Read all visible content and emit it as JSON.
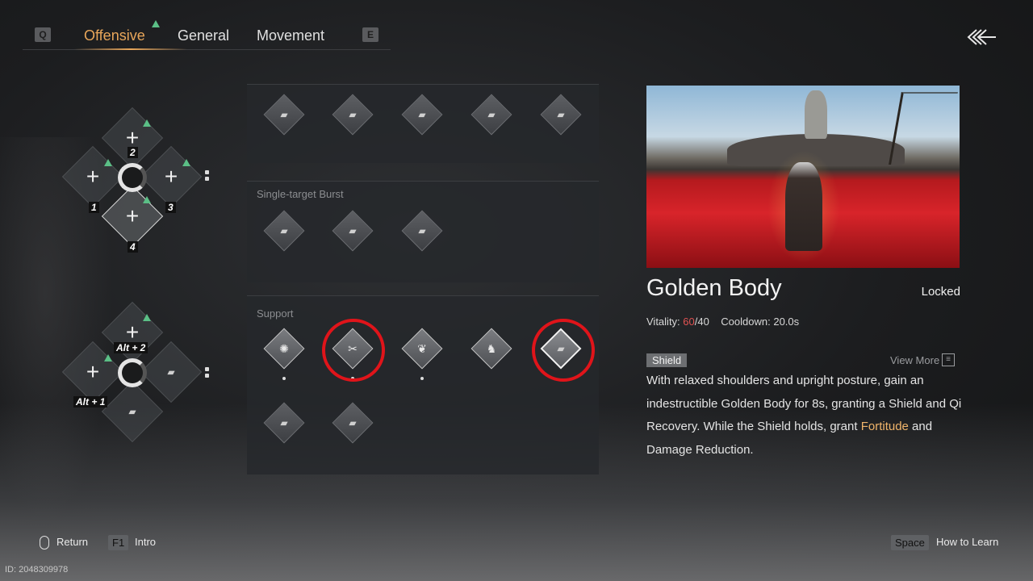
{
  "tabs": {
    "left_key": "Q",
    "right_key": "E",
    "items": [
      "Offensive",
      "General",
      "Movement"
    ],
    "active": "Offensive"
  },
  "wheel_upper": {
    "labels": [
      "2",
      "1",
      "3",
      "4"
    ]
  },
  "wheel_lower": {
    "labels": [
      "Alt + 2",
      "Alt + 1"
    ]
  },
  "skill_groups": [
    {
      "title": "",
      "count": 5
    },
    {
      "title": "Single-target Burst",
      "count": 3
    },
    {
      "title": "Support",
      "count": 7
    }
  ],
  "detail": {
    "name": "Golden Body",
    "status": "Locked",
    "vitality_label": "Vitality:",
    "vitality_current": "60",
    "vitality_max": "/40",
    "cooldown_label": "Cooldown: 20.0s",
    "tag": "Shield",
    "view_more": "View More",
    "desc_1": "With relaxed shoulders and upright posture, gain an indestructible Golden Body for 8s, granting a Shield and Qi Recovery. While the Shield holds, grant ",
    "desc_highlight": "Fortitude",
    "desc_2": " and Damage Reduction."
  },
  "bottom": {
    "return": "Return",
    "intro_key": "F1",
    "intro": "Intro",
    "learn_key": "Space",
    "learn": "How to Learn"
  },
  "id_text": "ID: 2048309978",
  "colors": {
    "accent": "#e8a65a",
    "highlight_circle": "#e0141a",
    "green_indicator": "#5bbf86"
  }
}
